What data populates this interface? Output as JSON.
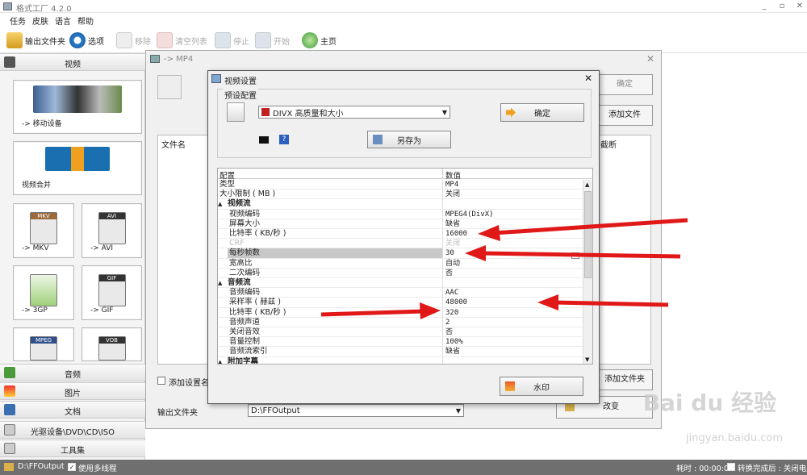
{
  "app": {
    "title": "格式工厂 4.2.0"
  },
  "menu": [
    "任务",
    "皮肤",
    "语言",
    "帮助"
  ],
  "toolbar": {
    "output_folder": "输出文件夹",
    "options": "选项",
    "remove": "移除",
    "clear_list": "清空列表",
    "stop": "停止",
    "start": "开始",
    "home": "主页"
  },
  "left": {
    "video_header": "视频",
    "mobile": "-> 移动设备",
    "merge": "视频合并",
    "formats": [
      {
        "label": "-> MKV",
        "icon": "mkv-file-icon",
        "badge": "MKV"
      },
      {
        "label": "-> AVI",
        "icon": "avi-file-icon",
        "badge": "AVI"
      },
      {
        "label": "-> 3GP",
        "icon": "3gp-file-icon",
        "badge": "3GP"
      },
      {
        "label": "-> GIF",
        "icon": "gif-file-icon",
        "badge": "GIF"
      },
      {
        "label": "",
        "icon": "mpeg-file-icon",
        "badge": "MPEG"
      },
      {
        "label": "",
        "icon": "vob-file-icon",
        "badge": "VOB"
      }
    ],
    "audio": "音频",
    "image": "图片",
    "document": "文档",
    "rom": "光驱设备\\DVD\\CD\\ISO",
    "tools": "工具集"
  },
  "behind": {
    "title": "-> MP4",
    "ok": "确定",
    "add_file": "添加文件",
    "col_filename": "文件名",
    "col_cut": "截断",
    "add_setting_name": "添加设置名称",
    "add_folder": "添加文件夹",
    "output_folder_label": "输出文件夹",
    "output_path": "D:\\FFOutput",
    "change": "改变"
  },
  "dialog": {
    "title": "视频设置",
    "preset_label": "预设配置",
    "preset_value": "DIVX 高质量和大小",
    "ok": "确定",
    "save_as": "另存为",
    "watermark": "水印",
    "col_config": "配置",
    "col_value": "数值",
    "rows": [
      {
        "k": "类型",
        "v": "MP4",
        "kind": ""
      },
      {
        "k": "大小限制 ( MB )",
        "v": "关闭",
        "kind": ""
      },
      {
        "k": "视频流",
        "v": "",
        "kind": "sec"
      },
      {
        "k": "视频编码",
        "v": "MPEG4(DivX)",
        "kind": "ind"
      },
      {
        "k": "屏幕大小",
        "v": "缺省",
        "kind": "ind"
      },
      {
        "k": "比特率 ( KB/秒 )",
        "v": "16000",
        "kind": "ind"
      },
      {
        "k": "CRF",
        "v": "关闭",
        "kind": "ind dim"
      },
      {
        "k": "每秒帧数",
        "v": "30",
        "kind": "ind hl"
      },
      {
        "k": "宽高比",
        "v": "自动",
        "kind": "ind"
      },
      {
        "k": "二次编码",
        "v": "否",
        "kind": "ind"
      },
      {
        "k": "音频流",
        "v": "",
        "kind": "sec"
      },
      {
        "k": "音频编码",
        "v": "AAC",
        "kind": "ind"
      },
      {
        "k": "采样率 ( 赫兹 )",
        "v": "48000",
        "kind": "ind"
      },
      {
        "k": "比特率 ( KB/秒 )",
        "v": "320",
        "kind": "ind"
      },
      {
        "k": "音频声道",
        "v": "2",
        "kind": "ind"
      },
      {
        "k": "关闭音效",
        "v": "否",
        "kind": "ind"
      },
      {
        "k": "音量控制",
        "v": "100%",
        "kind": "ind"
      },
      {
        "k": "音频流索引",
        "v": "缺省",
        "kind": "ind"
      },
      {
        "k": "附加字幕",
        "v": "",
        "kind": "sec"
      }
    ]
  },
  "status": {
    "path": "D:\\FFOutput",
    "multithread": "使用多线程",
    "elapsed": "耗时 : 00:00:00",
    "after": "转换完成后 : 关闭电脑"
  },
  "watermark": {
    "main": "Bai du 经验",
    "sub": "jingyan.baidu.com"
  },
  "colors": {
    "annotation_arrow": "#e01818",
    "status_bg": "#6f6f6f"
  }
}
